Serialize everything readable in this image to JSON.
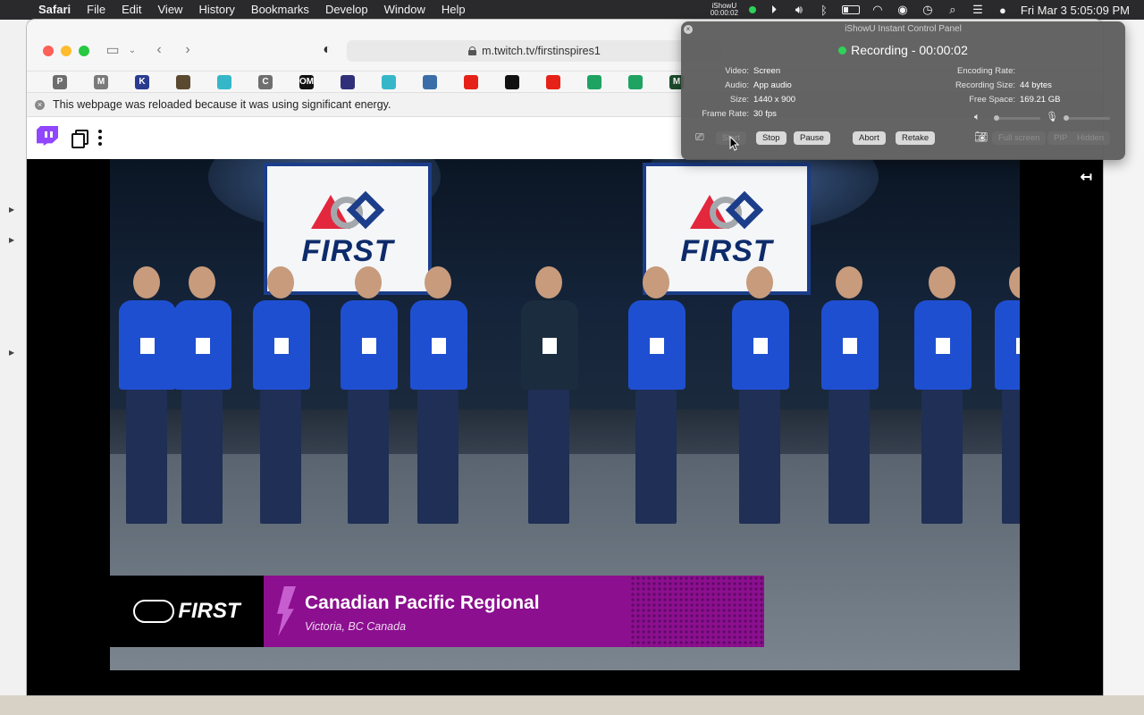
{
  "menubar": {
    "apple": "",
    "items": [
      "Safari",
      "File",
      "Edit",
      "View",
      "History",
      "Bookmarks",
      "Develop",
      "Window",
      "Help"
    ],
    "ishowu_line1": "iShowU",
    "ishowu_line2": "00:00:02",
    "datetime": "Fri Mar 3  5:05:09 PM"
  },
  "safari": {
    "url": "m.twitch.tv/firstinspires1",
    "favorites": [
      {
        "icon": "P",
        "color": "#6d6d6d"
      },
      {
        "icon": "M",
        "color": "#7a7a7a"
      },
      {
        "icon": "K",
        "color": "#2a3c8f"
      },
      {
        "icon": "",
        "color": "#5b4a2f"
      },
      {
        "icon": "",
        "color": "#35b7c9"
      },
      {
        "icon": "C",
        "color": "#6f6f6f"
      },
      {
        "icon": "OM",
        "color": "#111111"
      },
      {
        "icon": "",
        "color": "#30307a"
      },
      {
        "icon": "",
        "color": "#35b7c9"
      },
      {
        "icon": "",
        "color": "#3b6ea8"
      },
      {
        "icon": "",
        "color": "#e62117"
      },
      {
        "icon": "",
        "color": "#111111"
      },
      {
        "icon": "",
        "color": "#e62117"
      },
      {
        "icon": "",
        "color": "#1ea362"
      },
      {
        "icon": "",
        "color": "#1ea362"
      },
      {
        "icon": "M",
        "color": "#1d4d2c"
      }
    ],
    "energy_notice": "This webpage was reloaded because it was using significant energy."
  },
  "stream": {
    "banner_word": "FIRST",
    "lower_third_logo": "FIRST",
    "title": "Canadian Pacific Regional",
    "subtitle": "Victoria, BC Canada"
  },
  "ishowu": {
    "title": "iShowU Instant Control Panel",
    "status": "Recording - 00:00:02",
    "video_label": "Video:",
    "video_value": "Screen",
    "audio_label": "Audio:",
    "audio_value": "App audio",
    "size_label": "Size:",
    "size_value": "1440 x 900",
    "framerate_label": "Frame Rate:",
    "framerate_value": "30 fps",
    "encoding_label": "Encoding Rate:",
    "encoding_value": "",
    "recsize_label": "Recording Size:",
    "recsize_value": "44 bytes",
    "freespace_label": "Free Space:",
    "freespace_value": "169.21 GB",
    "buttons": {
      "start": "Start",
      "stop": "Stop",
      "pause": "Pause",
      "abort": "Abort",
      "retake": "Retake",
      "fullscreen": "Full screen",
      "pip": "PIP",
      "hidden": "Hidden"
    }
  },
  "colors": {
    "twitch": "#9146ff",
    "lower_third": "#8b0f8e",
    "rec_green": "#2fd158"
  }
}
